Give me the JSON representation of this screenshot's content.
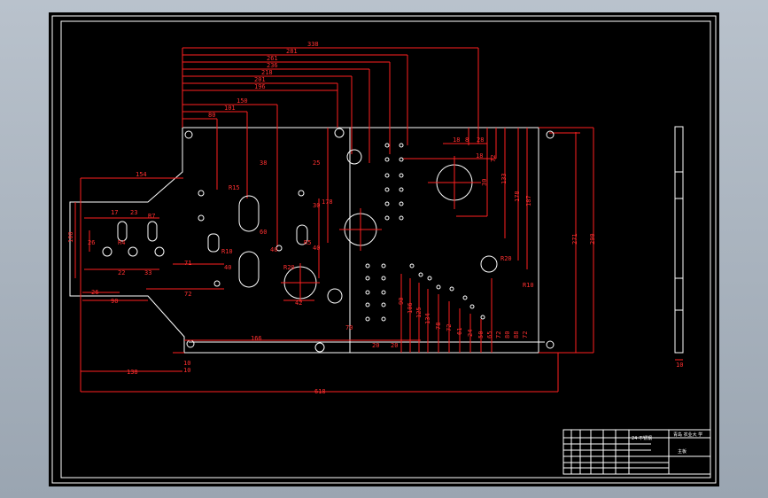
{
  "drawing": {
    "top_dimensions": [
      "338",
      "281",
      "261",
      "236",
      "218",
      "201",
      "196",
      "150",
      "101",
      "80"
    ],
    "right_dimensions": [
      "18",
      "8",
      "28",
      "18",
      "72",
      "30",
      "133",
      "178",
      "187",
      "271",
      "290"
    ],
    "left_dimensions": [
      "154",
      "100",
      "17",
      "23",
      "R7",
      "R4",
      "R15",
      "26",
      "22",
      "33",
      "71",
      "40",
      "72",
      "26",
      "90",
      "138",
      "10",
      "R10"
    ],
    "middle_dimensions": [
      "38",
      "25",
      "30",
      "178",
      "60",
      "40",
      "70",
      "40",
      "42",
      "R5",
      "R20"
    ],
    "bottom_dimensions": [
      "166",
      "20",
      "20",
      "618",
      "10"
    ],
    "right_hole_dimensions": [
      "R20",
      "R10"
    ],
    "vertical_ladder": [
      "90",
      "106",
      "125",
      "134",
      "78",
      "72",
      "61",
      "24",
      "50",
      "65",
      "72",
      "80",
      "88",
      "72"
    ],
    "side_view_dimension": "10"
  },
  "title_block": {
    "drawing_name": "24 不锈钢",
    "company_name": "青岛 农业大 学",
    "part_name": "主板"
  }
}
